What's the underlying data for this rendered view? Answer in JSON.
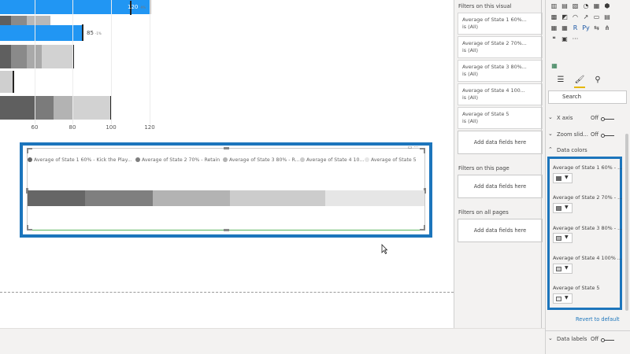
{
  "bullet_chart": {
    "rows": [
      {
        "value_label": "120",
        "sub_label": "-9%"
      },
      {
        "value_label": "85",
        "sub_label": "-1%"
      },
      {
        "value_label": "",
        "sub_label": ""
      },
      {
        "value_label": "",
        "sub_label": ""
      },
      {
        "value_label": "",
        "sub_label": ""
      }
    ],
    "ticks": [
      "60",
      "80",
      "100",
      "120"
    ]
  },
  "selected_visual": {
    "legend": [
      {
        "label": "Average of State 1 60% - Kick the Play...",
        "color": "#666666"
      },
      {
        "label": "Average of State 2 70% - Retain",
        "color": "#7f7f7f"
      },
      {
        "label": "Average of State 3 80% - R...",
        "color": "#b3b3b3"
      },
      {
        "label": "Average of State 4 10...",
        "color": "#cccccc"
      },
      {
        "label": "Average of State 5",
        "color": "#e6e6e6"
      }
    ],
    "segments": [
      {
        "fraction": 0.145,
        "color": "#666666"
      },
      {
        "fraction": 0.17,
        "color": "#7f7f7f"
      },
      {
        "fraction": 0.195,
        "color": "#b3b3b3"
      },
      {
        "fraction": 0.24,
        "color": "#cccccc"
      },
      {
        "fraction": 0.25,
        "color": "#e6e6e6"
      }
    ]
  },
  "filters": {
    "visual_title": "Filters on this visual",
    "visual_cards": [
      {
        "line1": "Average of State 1 60%...",
        "line2": "is (All)"
      },
      {
        "line1": "Average of State 2 70%...",
        "line2": "is (All)"
      },
      {
        "line1": "Average of State 3 80%...",
        "line2": "is (All)"
      },
      {
        "line1": "Average of State 4 100...",
        "line2": "is (All)"
      },
      {
        "line1": "Average of State 5",
        "line2": "is (All)"
      }
    ],
    "add_data": "Add data fields here",
    "page_title": "Filters on this page",
    "all_pages_title": "Filters on all pages"
  },
  "visualizations": {
    "search_placeholder": "Search",
    "settings": [
      {
        "label": "X axis",
        "state": "Off"
      },
      {
        "label": "Zoom slid...",
        "state": "Off"
      }
    ],
    "data_colors_title": "Data colors",
    "data_colors": [
      {
        "label": "Average of State 1 60% - ...",
        "color": "#666666"
      },
      {
        "label": "Average of State 2 70% - ...",
        "color": "#7f7f7f"
      },
      {
        "label": "Average of State 3 80% - ...",
        "color": "#b3b3b3"
      },
      {
        "label": "Average of State 4 100% ...",
        "color": "#cccccc"
      },
      {
        "label": "Average of State 5",
        "color": "#e6e6e6"
      }
    ],
    "revert": "Revert to default",
    "data_labels": {
      "label": "Data labels",
      "state": "Off"
    },
    "viz_icons": [
      "bar-chart-icon",
      "stacked-column-icon",
      "line-chart-icon",
      "pie-chart-icon",
      "table-icon",
      "map-icon",
      "filled-map-icon",
      "shape-map-icon",
      "gauge-icon",
      "kpi-icon",
      "card-icon",
      "multi-row-card-icon",
      "slicer-icon",
      "matrix-icon",
      "r-visual-icon",
      "python-visual-icon",
      "key-influencers-icon",
      "decomposition-tree-icon",
      "qa-icon",
      "smart-narrative-icon",
      "more-visuals-icon"
    ]
  }
}
